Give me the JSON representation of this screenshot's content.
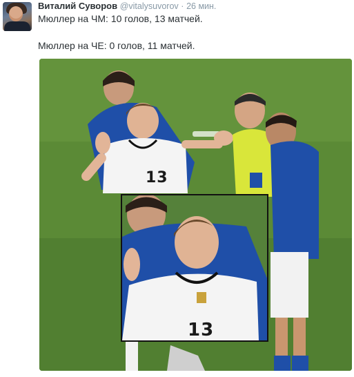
{
  "tweet": {
    "author_name": "Виталий Суворов",
    "author_handle": "@vitalysuvorov",
    "separator": "·",
    "time": "26 мин.",
    "line1": "Мюллер на ЧМ: 10 голов, 13 матчей.",
    "line2": "Мюллер на ЧЕ: 0 голов, 11 матчей.",
    "media": {
      "jersey_number": "13",
      "inset_jersey_number": "13",
      "colors": {
        "pitch": "#4f7c2f",
        "italy_kit": "#1f4fa8",
        "germany_kit": "#f4f4f4",
        "referee_kit": "#d9e63a"
      }
    }
  }
}
